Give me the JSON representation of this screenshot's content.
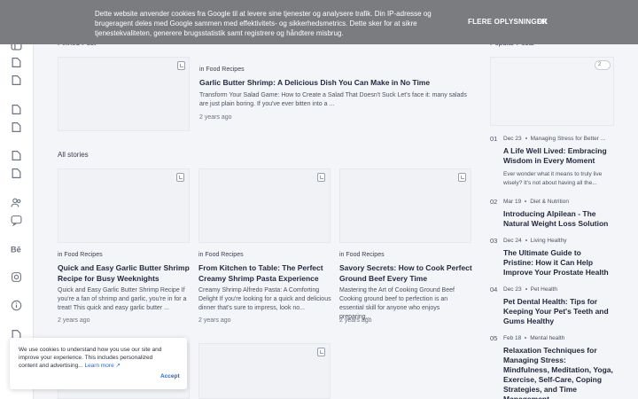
{
  "cookie_bar": {
    "message": "Dette website anvender cookies fra Google til at levere sine tjenester og analysere trafik. Din IP-adresse og brugeragent deles med Google sammen med effektivitets- og sikkerhedsmetrics. Dette sker for at sikre tjenestekvaliteten, generere brugsstatistik samt registrere og håndtere misbrug.",
    "more_label": "FLERE OPLYSNINGER",
    "ok_label": "OK"
  },
  "pinned": {
    "heading": "Pinned Post",
    "category_prefix": "in",
    "category": "Food Recipes",
    "title": "Garlic Butter Shrimp: A Delicious Dish You Can Make in No Time",
    "excerpt": "Transform Your Salad Game: How to Create a Salad That Doesn't Suck  Let's face it: many salads are just plain boring. If you've ever bitten into a ...",
    "time": "2 years ago"
  },
  "all_stories": {
    "heading": "All stories",
    "posts": [
      {
        "category_prefix": "in",
        "category": "Food Recipes",
        "title": "Quick and Easy Garlic Butter Shrimp Recipe for Busy Weeknights",
        "excerpt": "Quick and Easy Garlic Butter Shrimp Recipe If you're a fan of shrimp and garlic, you're in for a treat! This quick and easy garlic butter ...",
        "time": "2 years ago"
      },
      {
        "category_prefix": "in",
        "category": "Food Recipes",
        "title": "From Kitchen to Table: The Perfect Creamy Shrimp Pasta Experience",
        "excerpt": "Creamy Shrimp Alfredo Pasta: A Comforting Delight  If you're looking for a quick and delicious dinner that's sure to impress, look no...",
        "time": "2 years ago"
      },
      {
        "category_prefix": "in",
        "category": "Food Recipes",
        "title": "Savory Secrets: How to Cook Perfect Ground Beef Every Time",
        "excerpt": "Mastering the Art of Cooking Ground Beef Cooking ground beef to perfection is an essential skill for anyone who enjoys preparing...",
        "time": "2 years ago"
      }
    ]
  },
  "popular": {
    "heading": "Popular Posts",
    "badge_count": "2",
    "items": [
      {
        "num": "01",
        "date": "Dec 23",
        "category": "Managing Stress for Better ...",
        "title": "A Life Well Lived: Embracing Wisdom in Every Moment",
        "excerpt": "Ever wonder what it means to truly live wisely? It's not about having all the..."
      },
      {
        "num": "02",
        "date": "Mar 19",
        "category": "Diet & Nutrition",
        "title": "Introducing Alpilean - The Natural Weight Loss Solution",
        "excerpt": ""
      },
      {
        "num": "03",
        "date": "Dec 24",
        "category": "Living Healthy",
        "title": "The Ultimate Guide to Pristine: How it Can Help Improve Your Prostate Health",
        "excerpt": ""
      },
      {
        "num": "04",
        "date": "Dec 23",
        "category": "Pet Health",
        "title": "Pet Dental Health: Tips for Keeping Your Pet's Teeth and Gums Healthy",
        "excerpt": ""
      },
      {
        "num": "05",
        "date": "Feb 18",
        "category": "Mental health",
        "title": "Relaxation Techniques for Managing Stress: Mindfulness, Meditation, Yoga, Exercise, Self-Care, Coping Strategies, and Time Management",
        "excerpt": ""
      }
    ]
  },
  "consent": {
    "message": "We use cookies to understand how you use our site and improve your experience. This includes personalized content and advertising...",
    "learn_more": "Learn more",
    "accept_label": "Accept"
  },
  "rail_icons": [
    "sidebar-toggle-icon",
    "document-icon",
    "document-icon",
    "document-icon",
    "document-icon",
    "document-icon",
    "document-icon",
    "users-icon",
    "chat-icon",
    "behance-icon",
    "instagram-icon",
    "info-icon",
    "document-icon"
  ]
}
